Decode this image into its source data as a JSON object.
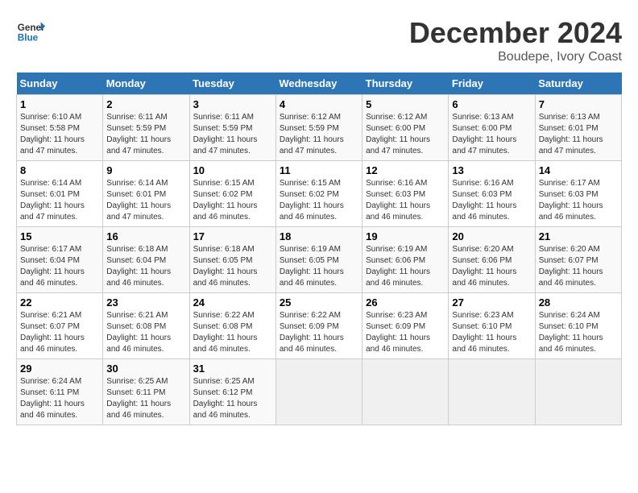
{
  "logo": {
    "text_general": "General",
    "text_blue": "Blue"
  },
  "title": "December 2024",
  "subtitle": "Boudepe, Ivory Coast",
  "days_of_week": [
    "Sunday",
    "Monday",
    "Tuesday",
    "Wednesday",
    "Thursday",
    "Friday",
    "Saturday"
  ],
  "weeks": [
    [
      {
        "day": "1",
        "rise": "6:10 AM",
        "set": "5:58 PM",
        "daylight": "11 hours and 47 minutes."
      },
      {
        "day": "2",
        "rise": "6:11 AM",
        "set": "5:59 PM",
        "daylight": "11 hours and 47 minutes."
      },
      {
        "day": "3",
        "rise": "6:11 AM",
        "set": "5:59 PM",
        "daylight": "11 hours and 47 minutes."
      },
      {
        "day": "4",
        "rise": "6:12 AM",
        "set": "5:59 PM",
        "daylight": "11 hours and 47 minutes."
      },
      {
        "day": "5",
        "rise": "6:12 AM",
        "set": "6:00 PM",
        "daylight": "11 hours and 47 minutes."
      },
      {
        "day": "6",
        "rise": "6:13 AM",
        "set": "6:00 PM",
        "daylight": "11 hours and 47 minutes."
      },
      {
        "day": "7",
        "rise": "6:13 AM",
        "set": "6:01 PM",
        "daylight": "11 hours and 47 minutes."
      }
    ],
    [
      {
        "day": "8",
        "rise": "6:14 AM",
        "set": "6:01 PM",
        "daylight": "11 hours and 47 minutes."
      },
      {
        "day": "9",
        "rise": "6:14 AM",
        "set": "6:01 PM",
        "daylight": "11 hours and 47 minutes."
      },
      {
        "day": "10",
        "rise": "6:15 AM",
        "set": "6:02 PM",
        "daylight": "11 hours and 46 minutes."
      },
      {
        "day": "11",
        "rise": "6:15 AM",
        "set": "6:02 PM",
        "daylight": "11 hours and 46 minutes."
      },
      {
        "day": "12",
        "rise": "6:16 AM",
        "set": "6:03 PM",
        "daylight": "11 hours and 46 minutes."
      },
      {
        "day": "13",
        "rise": "6:16 AM",
        "set": "6:03 PM",
        "daylight": "11 hours and 46 minutes."
      },
      {
        "day": "14",
        "rise": "6:17 AM",
        "set": "6:03 PM",
        "daylight": "11 hours and 46 minutes."
      }
    ],
    [
      {
        "day": "15",
        "rise": "6:17 AM",
        "set": "6:04 PM",
        "daylight": "11 hours and 46 minutes."
      },
      {
        "day": "16",
        "rise": "6:18 AM",
        "set": "6:04 PM",
        "daylight": "11 hours and 46 minutes."
      },
      {
        "day": "17",
        "rise": "6:18 AM",
        "set": "6:05 PM",
        "daylight": "11 hours and 46 minutes."
      },
      {
        "day": "18",
        "rise": "6:19 AM",
        "set": "6:05 PM",
        "daylight": "11 hours and 46 minutes."
      },
      {
        "day": "19",
        "rise": "6:19 AM",
        "set": "6:06 PM",
        "daylight": "11 hours and 46 minutes."
      },
      {
        "day": "20",
        "rise": "6:20 AM",
        "set": "6:06 PM",
        "daylight": "11 hours and 46 minutes."
      },
      {
        "day": "21",
        "rise": "6:20 AM",
        "set": "6:07 PM",
        "daylight": "11 hours and 46 minutes."
      }
    ],
    [
      {
        "day": "22",
        "rise": "6:21 AM",
        "set": "6:07 PM",
        "daylight": "11 hours and 46 minutes."
      },
      {
        "day": "23",
        "rise": "6:21 AM",
        "set": "6:08 PM",
        "daylight": "11 hours and 46 minutes."
      },
      {
        "day": "24",
        "rise": "6:22 AM",
        "set": "6:08 PM",
        "daylight": "11 hours and 46 minutes."
      },
      {
        "day": "25",
        "rise": "6:22 AM",
        "set": "6:09 PM",
        "daylight": "11 hours and 46 minutes."
      },
      {
        "day": "26",
        "rise": "6:23 AM",
        "set": "6:09 PM",
        "daylight": "11 hours and 46 minutes."
      },
      {
        "day": "27",
        "rise": "6:23 AM",
        "set": "6:10 PM",
        "daylight": "11 hours and 46 minutes."
      },
      {
        "day": "28",
        "rise": "6:24 AM",
        "set": "6:10 PM",
        "daylight": "11 hours and 46 minutes."
      }
    ],
    [
      {
        "day": "29",
        "rise": "6:24 AM",
        "set": "6:11 PM",
        "daylight": "11 hours and 46 minutes."
      },
      {
        "day": "30",
        "rise": "6:25 AM",
        "set": "6:11 PM",
        "daylight": "11 hours and 46 minutes."
      },
      {
        "day": "31",
        "rise": "6:25 AM",
        "set": "6:12 PM",
        "daylight": "11 hours and 46 minutes."
      },
      null,
      null,
      null,
      null
    ]
  ]
}
